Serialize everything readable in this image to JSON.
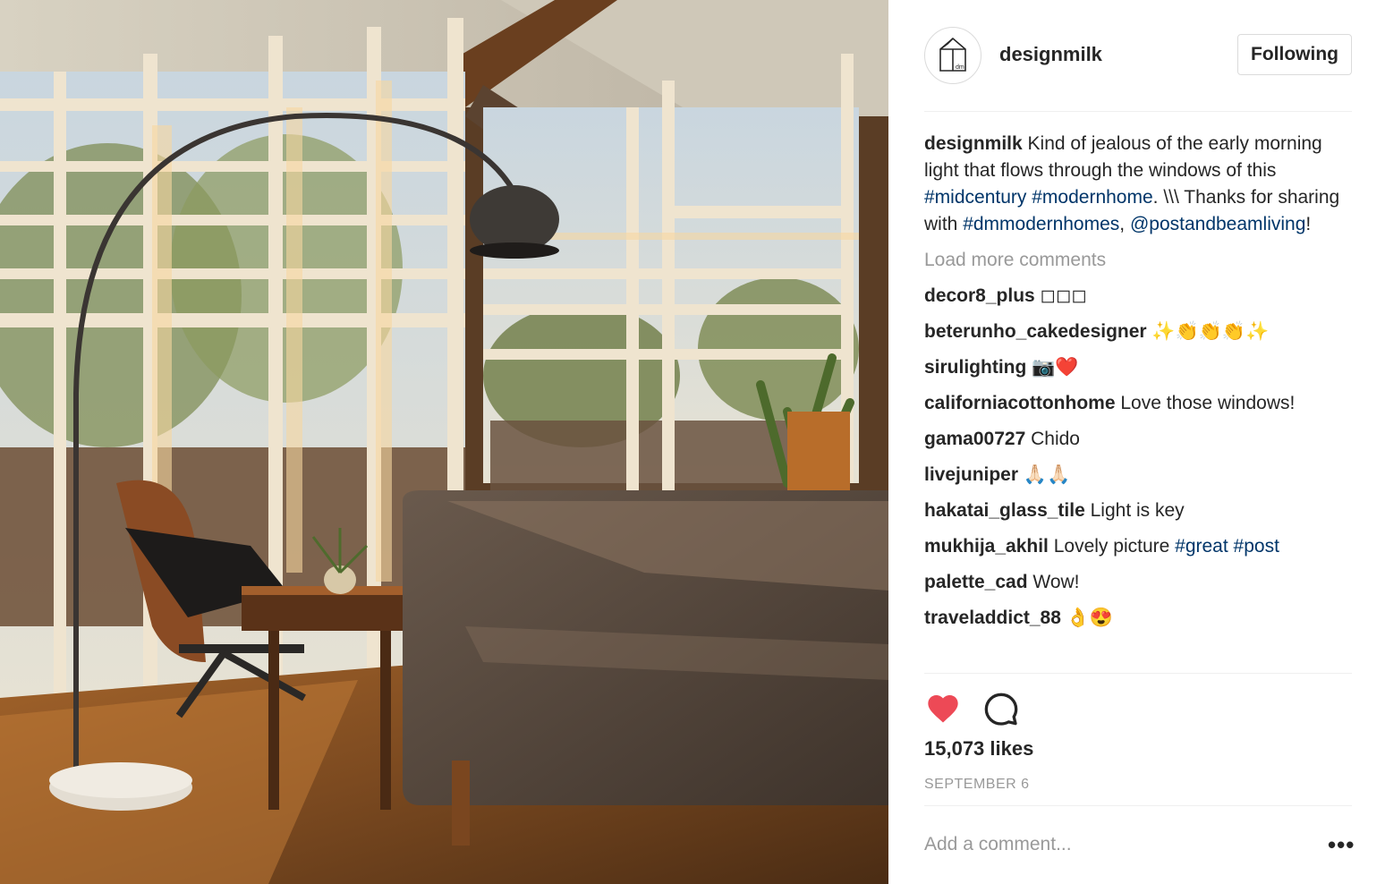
{
  "post": {
    "username": "designmilk",
    "avatar_text": "dm",
    "follow_label": "Following",
    "caption": {
      "username": "designmilk",
      "text1": " Kind of jealous of the early morning light that flows through the windows of this ",
      "tag1": "#midcentury",
      "space1": " ",
      "tag2": "#modernhome",
      "text2": ". \\\\\\ Thanks for sharing with ",
      "tag3": "#dmmodernhomes",
      "text3": ", ",
      "tag4": "@postandbeamliving",
      "text4": "!"
    },
    "load_more_label": "Load more comments",
    "comments": [
      {
        "user": "decor8_plus",
        "text": " ◻◻◻"
      },
      {
        "user": "beterunho_cakedesigner",
        "text": " ✨👏👏👏✨"
      },
      {
        "user": "sirulighting",
        "text": " 📷❤️"
      },
      {
        "user": "californiacottonhome",
        "text": " Love those windows!"
      },
      {
        "user": "gama00727",
        "text": " Chido"
      },
      {
        "user": "livejuniper",
        "text": " 🙏🏻🙏🏻"
      },
      {
        "user": "hakatai_glass_tile",
        "text": " Light is key"
      },
      {
        "user": "mukhija_akhil",
        "text": " Lovely picture ",
        "tag1": "#great",
        "sep": " ",
        "tag2": "#post"
      },
      {
        "user": "palette_cad",
        "text": " Wow!"
      },
      {
        "user": "traveladdict_88",
        "text": " 👌😍"
      }
    ],
    "likes_label": "15,073 likes",
    "date_label": "SEPTEMBER 6",
    "add_comment_placeholder": "Add a comment...",
    "more_label": "•••",
    "colors": {
      "heart": "#ed4956",
      "hashtag": "#003569",
      "muted": "#999999",
      "text": "#262626"
    },
    "icons": [
      "heart-icon",
      "comment-icon",
      "more-icon"
    ]
  }
}
